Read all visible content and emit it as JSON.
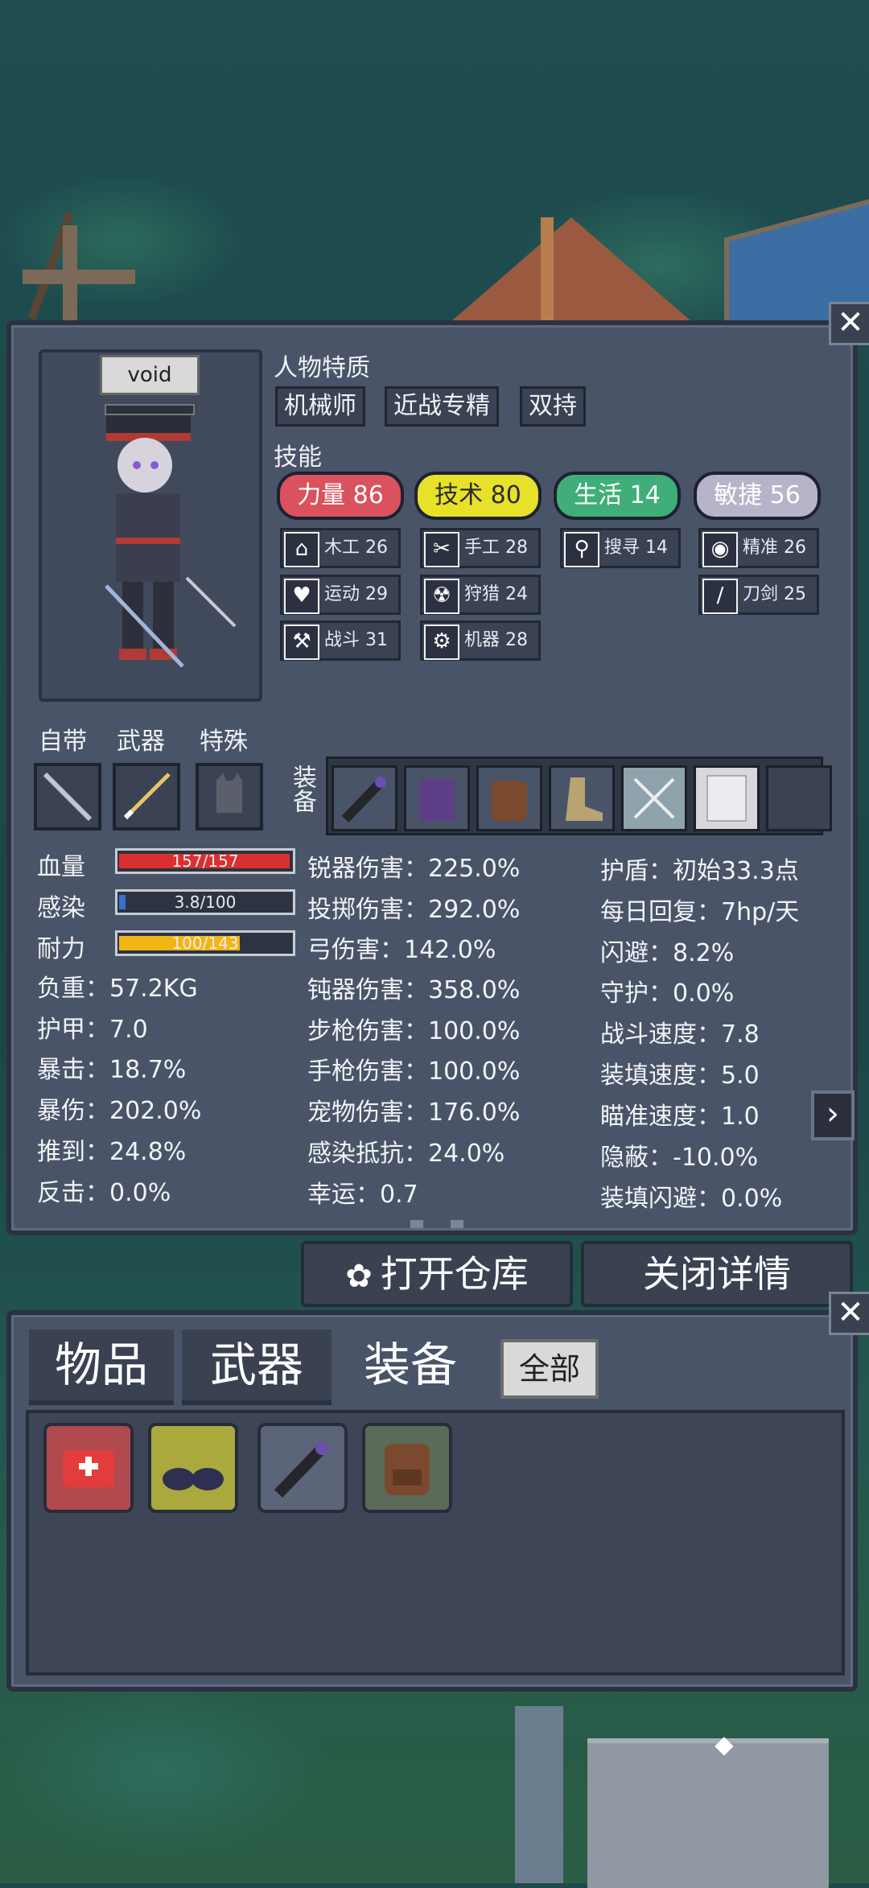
{
  "character": {
    "name": "void"
  },
  "traits": {
    "label": "人物特质",
    "items": [
      "机械师",
      "近战专精",
      "双持"
    ]
  },
  "skills": {
    "label": "技能",
    "main": [
      {
        "text": "力量 86",
        "color": "#d9525e"
      },
      {
        "text": "技术 80",
        "color": "#e8e12a"
      },
      {
        "text": "生活 14",
        "color": "#3fae78"
      },
      {
        "text": "敏捷 56",
        "color": "#b9b3c9"
      }
    ],
    "sub": [
      {
        "icon": "house-icon",
        "glyph": "⌂",
        "text": "木工 26"
      },
      {
        "icon": "heart-icon",
        "glyph": "♥",
        "text": "运动 29"
      },
      {
        "icon": "hammer-icon",
        "glyph": "⚒",
        "text": "战斗 31"
      },
      {
        "icon": "scissors-icon",
        "glyph": "✂",
        "text": "手工 28"
      },
      {
        "icon": "radiation-icon",
        "glyph": "☢",
        "text": "狩猎 24"
      },
      {
        "icon": "gear-icon",
        "glyph": "⚙",
        "text": "机器 28"
      },
      {
        "icon": "magnifier-icon",
        "glyph": "⚲",
        "text": "搜寻 14"
      },
      {
        "icon": "eye-icon",
        "glyph": "◉",
        "text": "精准 26"
      },
      {
        "icon": "sword-icon",
        "glyph": "/",
        "text": "刀剑 25"
      }
    ]
  },
  "slots": {
    "labels": [
      "自带",
      "武器",
      "特殊"
    ],
    "equip_label": "装备"
  },
  "bars": [
    {
      "label": "血量",
      "text": "157/157",
      "fraction": 1.0,
      "color": "#d9302f"
    },
    {
      "label": "感染",
      "text": "3.8/100",
      "fraction": 0.038,
      "color": "#3a6fd1"
    },
    {
      "label": "耐力",
      "text": "100/143",
      "fraction": 0.7,
      "color": "#f2b516"
    }
  ],
  "stats_left": [
    "负重：57.2KG",
    "护甲：7.0",
    "暴击：18.7%",
    "暴伤：202.0%",
    "推到：24.8%",
    "反击：0.0%"
  ],
  "stats_mid": [
    "锐器伤害：225.0%",
    "投掷伤害：292.0%",
    "弓伤害：142.0%",
    "钝器伤害：358.0%",
    "步枪伤害：100.0%",
    "手枪伤害：100.0%",
    "宠物伤害：176.0%",
    "感染抵抗：24.0%",
    "幸运：0.7"
  ],
  "stats_right": [
    "护盾：初始33.3点",
    "每日回复：7hp/天",
    "闪避：8.2%",
    "守护：0.0%",
    "战斗速度：7.8",
    "装填速度：5.0",
    "瞄准速度：1.0",
    "隐蔽：-10.0%",
    "装填闪避：0.0%"
  ],
  "buttons": {
    "open_storage": "打开仓库",
    "close_details": "关闭详情",
    "close_glyph": "✕",
    "next_glyph": "›"
  },
  "inventory": {
    "tabs": [
      "物品",
      "武器",
      "装备"
    ],
    "filter": "全部"
  }
}
